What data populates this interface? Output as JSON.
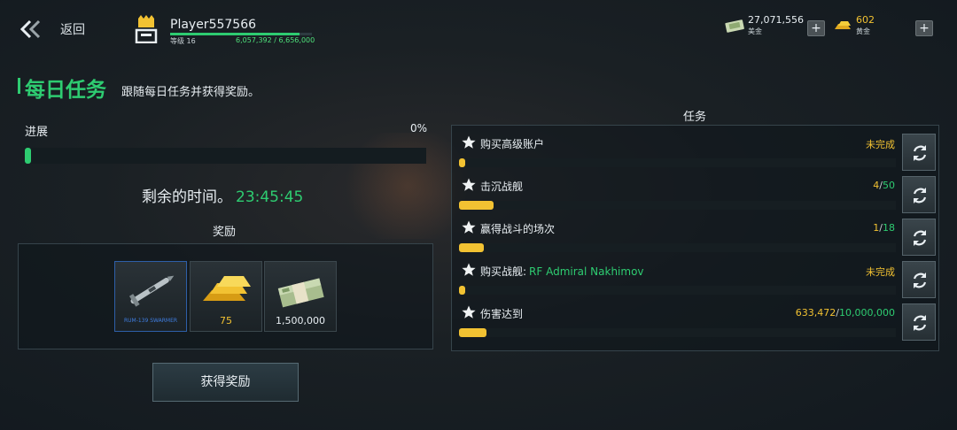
{
  "header": {
    "back_label": "返回",
    "player_name": "Player557566",
    "level_label": "等级 16",
    "xp_text": "6,057,392 / 6,656,000",
    "xp_fraction": 0.91
  },
  "currencies": [
    {
      "icon": "cash-icon",
      "value": "27,071,556",
      "label": "美金",
      "value_color": "#e8eef2"
    },
    {
      "icon": "gold-bars-icon",
      "value": "602",
      "label": "黄金",
      "value_color": "#f2c232"
    }
  ],
  "title": {
    "main": "每日任务",
    "subtitle": "跟随每日任务并获得奖励。"
  },
  "progress": {
    "label": "进展",
    "percent_text": "0%",
    "fraction": 0.0
  },
  "time": {
    "label": "剩余的时间。",
    "value": "23:45:45"
  },
  "rewards": {
    "title": "奖励",
    "items": [
      {
        "icon": "missile-icon",
        "label": "RUM-139 SWARMER"
      },
      {
        "icon": "gold-bars-icon",
        "label": "75"
      },
      {
        "icon": "cash-stack-icon",
        "label": "1,500,000"
      }
    ]
  },
  "claim_button": "获得奖励",
  "tasks": {
    "title": "任务",
    "items": [
      {
        "name": "购买高级账户",
        "ship": "",
        "status": "未完成",
        "current": "",
        "sep": "",
        "total": "",
        "fraction": 0.0
      },
      {
        "name": "击沉战舰",
        "ship": "",
        "status": "",
        "current": "4",
        "sep": "/",
        "total": "50",
        "fraction": 0.08
      },
      {
        "name": "赢得战斗的场次",
        "ship": "",
        "status": "",
        "current": "1",
        "sep": "/",
        "total": "18",
        "fraction": 0.056
      },
      {
        "name": "购买战舰:",
        "ship": "RF Admiral Nakhimov",
        "status": "未完成",
        "current": "",
        "sep": "",
        "total": "",
        "fraction": 0.0
      },
      {
        "name": "伤害达到",
        "ship": "",
        "status": "",
        "current": "633,472",
        "sep": "/",
        "total": "10,000,000",
        "fraction": 0.063
      }
    ]
  },
  "colors": {
    "accent_green": "#2ecc71",
    "accent_gold": "#f2c232"
  }
}
